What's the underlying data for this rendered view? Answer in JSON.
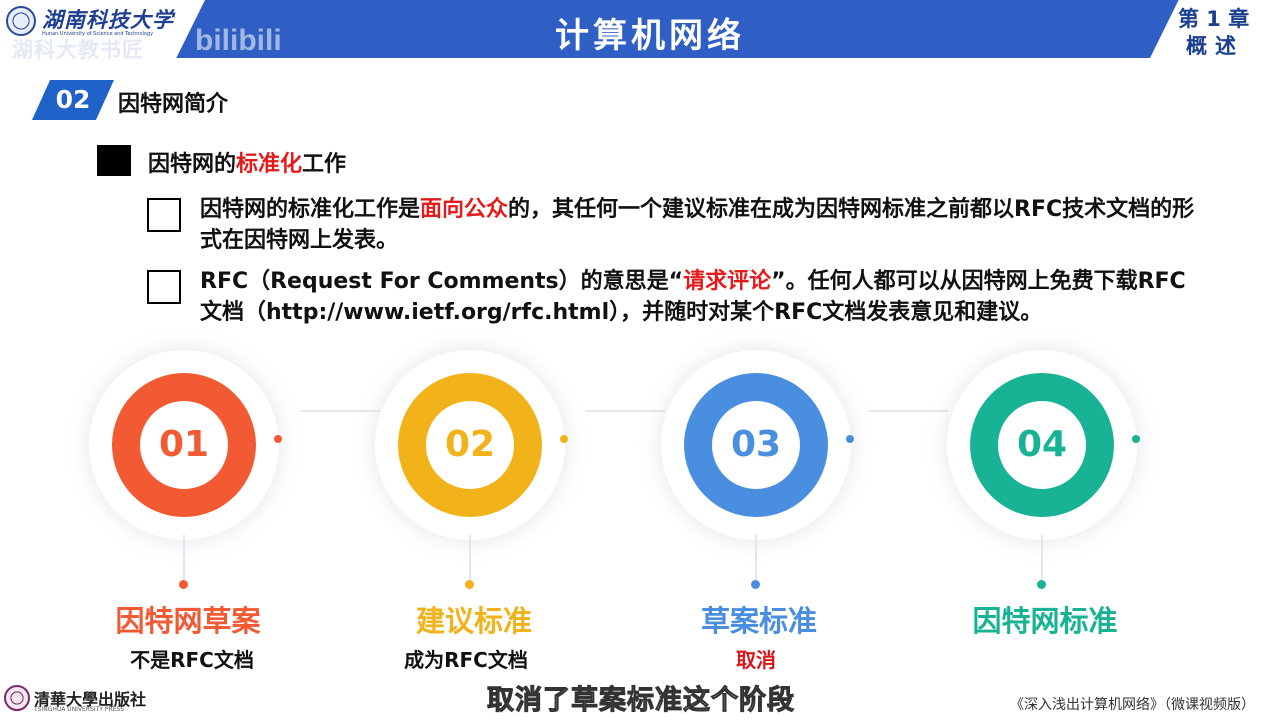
{
  "header": {
    "logo_cn": "湖南科技大学",
    "logo_en": "Hunan University of Science and Technology",
    "watermark": "湖科大教书匠",
    "watermark2": "bilibili",
    "title": "计算机网络",
    "chapter_line1": "第 1 章",
    "chapter_line2": "概述"
  },
  "section": {
    "number": "02",
    "title": "因特网简介"
  },
  "bullet": {
    "prefix": "因特网的",
    "highlight": "标准化",
    "suffix": "工作"
  },
  "points": [
    {
      "before": "因特网的标准化工作是",
      "highlight": "面向公众",
      "after": "的，其任何一个建议标准在成为因特网标准之前都以RFC技术文档的形式在因特网上发表。"
    },
    {
      "before": "RFC（Request For Comments）的意思是“",
      "highlight": "请求评论",
      "after": "”。任何人都可以从因特网上免费下载RFC文档（http://www.ietf.org/rfc.html），并随时对某个RFC文档发表意见和建议。"
    }
  ],
  "steps": [
    {
      "number": "01",
      "title": "因特网草案",
      "subtitle": "不是RFC文档",
      "color": "#f15a32",
      "sub_color": "#111111"
    },
    {
      "number": "02",
      "title": "建议标准",
      "subtitle": "成为RFC文档",
      "color": "#f2b21a",
      "sub_color": "#111111"
    },
    {
      "number": "03",
      "title": "草案标准",
      "subtitle": "取消",
      "color": "#4a8fdf",
      "sub_color": "#d9171b"
    },
    {
      "number": "04",
      "title": "因特网标准",
      "subtitle": "",
      "color": "#18b394",
      "sub_color": "#111111"
    }
  ],
  "footer": {
    "press_cn": "清華大學出版社",
    "press_en": "TSINGHUA UNIVERSITY PRESS",
    "caption": "取消了草案标准这个阶段",
    "book": "《深入浅出计算机网络》（微课视频版）"
  }
}
